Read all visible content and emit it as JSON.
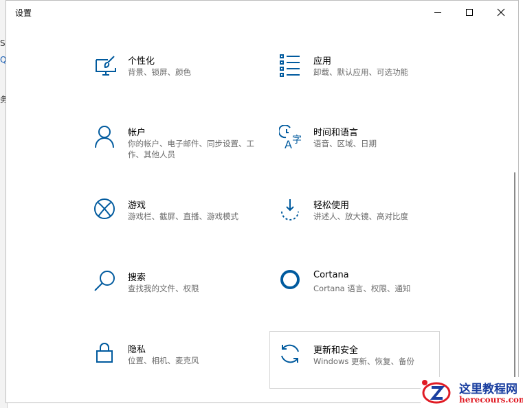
{
  "window": {
    "title": "设置"
  },
  "background_window": {
    "fragments": [
      "S",
      "Q",
      "务"
    ]
  },
  "tiles": [
    {
      "label": "个性化",
      "desc": "背景、锁屏、颜色",
      "icon": "personalization-icon"
    },
    {
      "label": "应用",
      "desc": "卸载、默认应用、可选功能",
      "icon": "apps-icon"
    },
    {
      "label": "帐户",
      "desc": "你的帐户、电子邮件、同步设置、工作、其他人员",
      "icon": "account-icon"
    },
    {
      "label": "时间和语言",
      "desc": "语音、区域、日期",
      "icon": "time-language-icon"
    },
    {
      "label": "游戏",
      "desc": "游戏栏、截屏、直播、游戏模式",
      "icon": "xbox-icon"
    },
    {
      "label": "轻松使用",
      "desc": "讲述人、放大镜、高对比度",
      "icon": "ease-of-access-icon"
    },
    {
      "label": "搜索",
      "desc": "查找我的文件、权限",
      "icon": "search-icon"
    },
    {
      "label": "Cortana",
      "desc": "Cortana 语言、权限、通知",
      "icon": "cortana-icon"
    },
    {
      "label": "隐私",
      "desc": "位置、相机、麦克风",
      "icon": "lock-icon"
    },
    {
      "label": "更新和安全",
      "desc": "Windows 更新、恢复、备份",
      "icon": "sync-icon"
    }
  ],
  "watermark": {
    "line1": "这里教程网",
    "line2": "herecours.com"
  },
  "colors": {
    "accent": "#005a9e",
    "text": "#000000",
    "secondary_text": "#6b6b6b"
  }
}
